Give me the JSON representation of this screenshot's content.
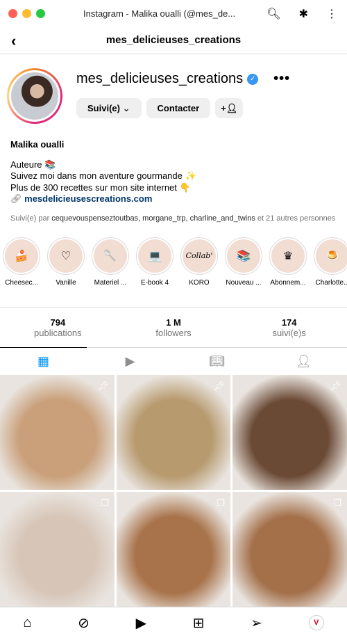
{
  "window": {
    "title": "Instagram - Malika oualli (@mes_de..."
  },
  "nav": {
    "title": "mes_delicieuses_creations"
  },
  "profile": {
    "username": "mes_delicieuses_creations",
    "verified": true,
    "follow_label": "Suivi(e)",
    "contact_label": "Contacter",
    "name": "Malika oualli",
    "bio": [
      "Auteure 📚",
      "Suivez moi dans mon aventure gourmande ✨",
      "Plus de 300 recettes sur mon site internet 👇"
    ],
    "link": "mesdelicieusescreations.com",
    "followed_by_prefix": "Suivi(e) par ",
    "followed_by_users": "cequevouspenseztoutbas, morgane_trp, charline_and_twins",
    "followed_by_suffix": " et 21 autres personnes"
  },
  "highlights": [
    {
      "label": "Cheesec...",
      "icon": "🍰"
    },
    {
      "label": "Vanille",
      "icon": "♡"
    },
    {
      "label": "Materiel ...",
      "icon": "🥄"
    },
    {
      "label": "E-book 4",
      "icon": "💻"
    },
    {
      "label": "KORO",
      "icon": "Collab'"
    },
    {
      "label": "Nouveau ...",
      "icon": "📚"
    },
    {
      "label": "Abonnem...",
      "icon": "♛"
    },
    {
      "label": "Charlotte...",
      "icon": "🍮"
    }
  ],
  "stats": [
    {
      "value": "794",
      "label": "publications"
    },
    {
      "value": "1 M",
      "label": "followers"
    },
    {
      "value": "174",
      "label": "suivi(e)s"
    }
  ],
  "posts": [
    {
      "bg": "#c9a07a",
      "pinned": true
    },
    {
      "bg": "#b79a6e",
      "pinned": true
    },
    {
      "bg": "#6b4a35",
      "pinned": true
    },
    {
      "bg": "#d7c6b8",
      "multi": true
    },
    {
      "bg": "#a8734a",
      "multi": true
    },
    {
      "bg": "#a4704a",
      "multi": true
    }
  ],
  "colors": {
    "accent": "#0095f6",
    "verified": "#3897f0"
  }
}
